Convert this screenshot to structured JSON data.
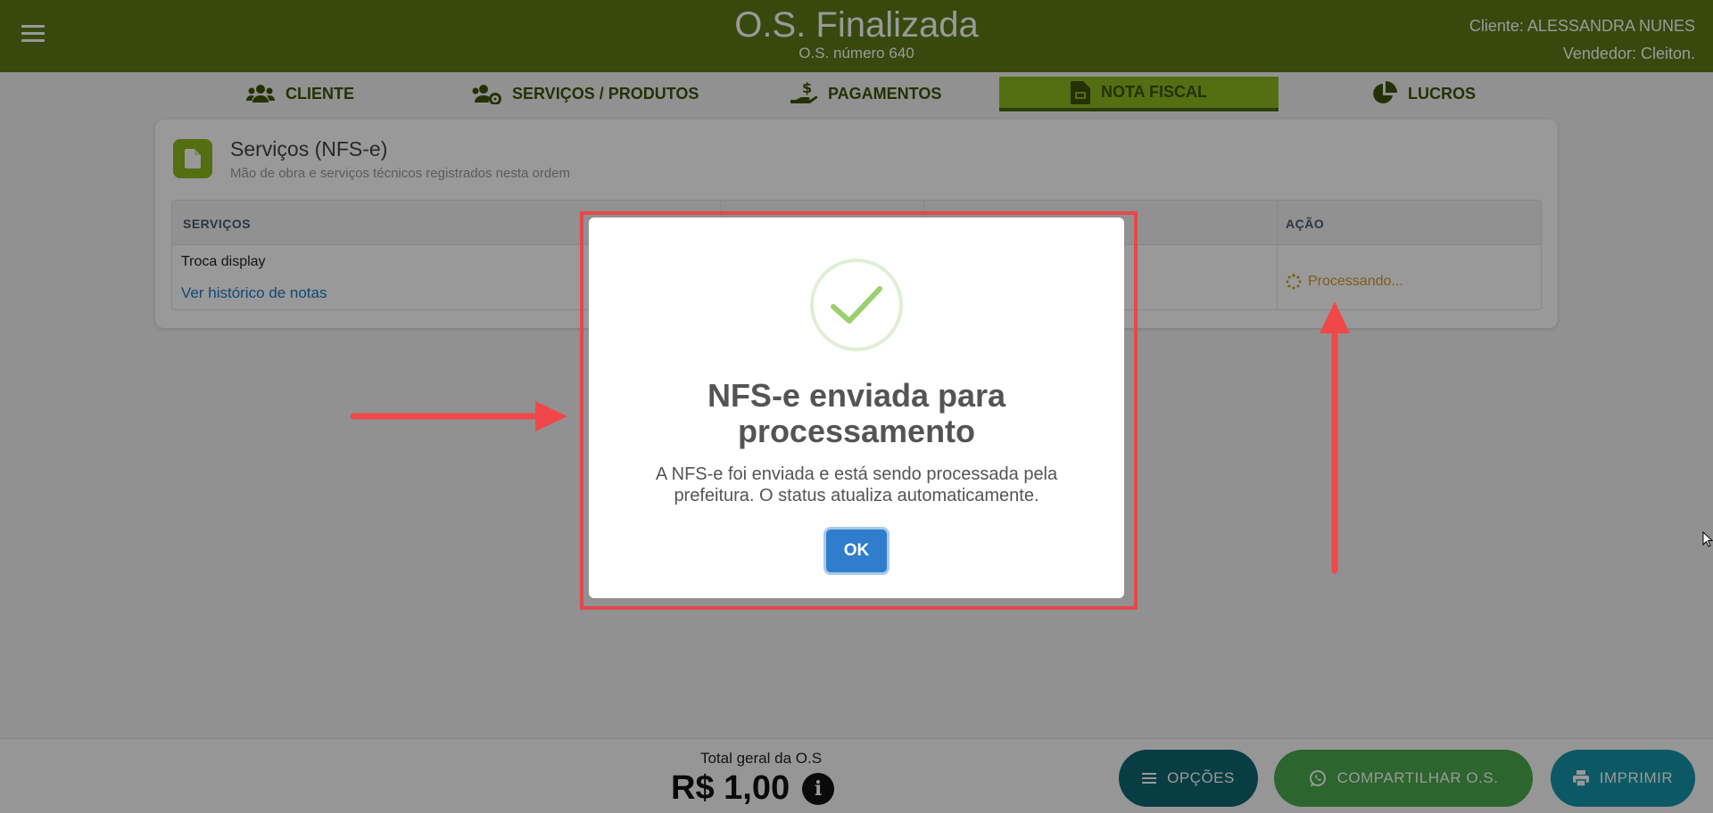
{
  "header": {
    "title": "O.S. Finalizada",
    "subtitle": "O.S. número 640",
    "client": "Cliente: ALESSANDRA NUNES",
    "seller": "Vendedor: Cleiton."
  },
  "tabs": [
    {
      "label": "CLIENTE",
      "icon": "users-icon"
    },
    {
      "label": "SERVIÇOS / PRODUTOS",
      "icon": "users-gear-icon"
    },
    {
      "label": "PAGAMENTOS",
      "icon": "hand-dollar-icon"
    },
    {
      "label": "NOTA FISCAL",
      "icon": "file-invoice-icon",
      "active": true
    },
    {
      "label": "LUCROS",
      "icon": "pie-chart-icon"
    }
  ],
  "card": {
    "title": "Serviços (NFS-e)",
    "subtitle": "Mão de obra e serviços técnicos registrados nesta ordem",
    "columns": [
      "SERVIÇOS",
      "AÇÃO"
    ],
    "row": {
      "service": "Troca display",
      "history_link": "Ver histórico de notas",
      "status": "Processando..."
    }
  },
  "footer": {
    "total_label": "Total geral da O.S",
    "total_value": "R$ 1,00",
    "buttons": {
      "options": "OPÇÕES",
      "share": "COMPARTILHAR O.S.",
      "print": "IMPRIMIR"
    }
  },
  "modal": {
    "title": "NFS-e enviada para processamento",
    "text": "A NFS-e foi enviada e está sendo processada pela prefeitura. O status atualiza automaticamente.",
    "ok": "OK"
  },
  "colors": {
    "header_bg": "#5d7a16",
    "active_tab": "#8cb81e",
    "link": "#1b7bc4",
    "processing": "#d39b2a",
    "ok_button": "#2f7dcc",
    "annotation_red": "#e5484d"
  }
}
